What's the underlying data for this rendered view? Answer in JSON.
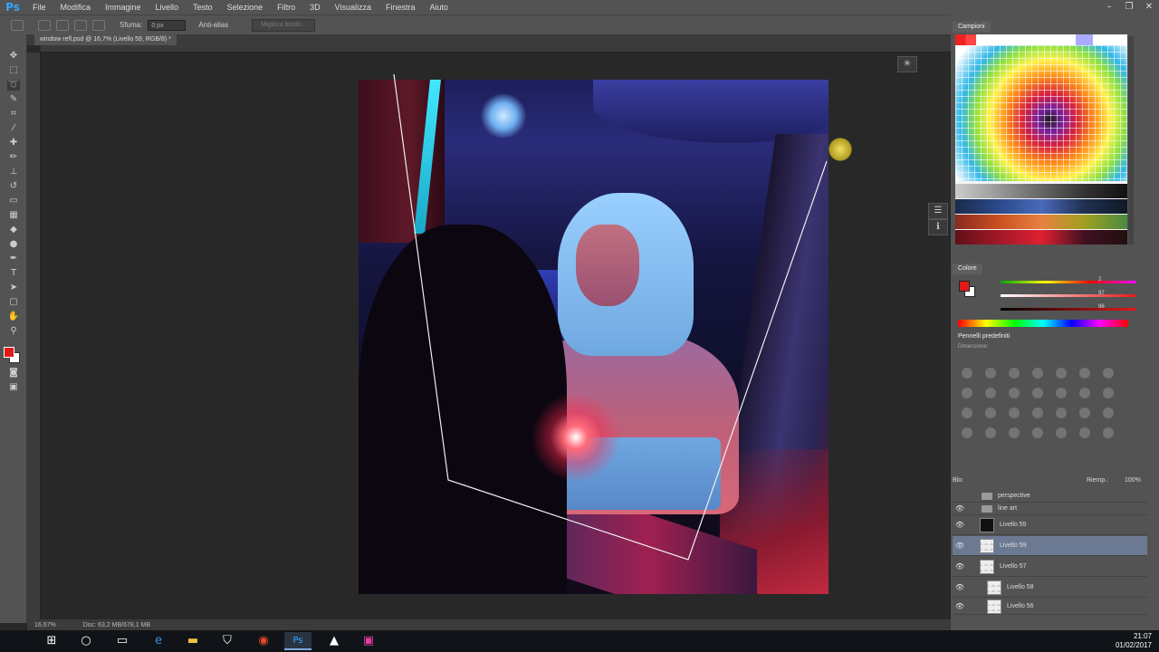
{
  "app": {
    "logo": "Ps"
  },
  "menu": [
    "File",
    "Modifica",
    "Immagine",
    "Livello",
    "Testo",
    "Selezione",
    "Filtro",
    "3D",
    "Visualizza",
    "Finestra",
    "Aiuto"
  ],
  "window_controls": {
    "minimize": "–",
    "restore": "❐",
    "close": "✕"
  },
  "options_bar": {
    "feather_label": "Sfuma:",
    "feather_value": "0 px",
    "antialias_label": "Anti-alias",
    "refine_button": "Migliora bordo..."
  },
  "document_tab": "window refl.psd @ 16,7% (Livello 59, RGB/8) *",
  "status": {
    "zoom": "16,67%",
    "doc_size": "Doc: 63,2 MB/678,1 MB"
  },
  "panels": {
    "swatches_tab": "Campioni",
    "color_tab": "Colore",
    "color_values": {
      "r": "2",
      "g": "97",
      "b": "96"
    },
    "presets_tab": "Pennelli predefiniti",
    "presets_label": "Dimensione:"
  },
  "layers": {
    "header_kind": "Blo:",
    "opacity_label": "Riemp.:",
    "opacity_value": "100%",
    "items": [
      {
        "name": "perspective",
        "type": "folder",
        "visible": false,
        "selected": false
      },
      {
        "name": "line art",
        "type": "folder",
        "visible": true,
        "selected": false
      },
      {
        "name": "Livello 55",
        "type": "layer",
        "visible": true,
        "selected": false
      },
      {
        "name": "Livello 59",
        "type": "layer",
        "visible": true,
        "selected": true
      },
      {
        "name": "Livello 57",
        "type": "layer",
        "visible": true,
        "selected": false
      },
      {
        "name": "Livello 58",
        "type": "layer",
        "visible": true,
        "selected": false
      },
      {
        "name": "Livello 56",
        "type": "layer",
        "visible": true,
        "selected": false
      }
    ]
  },
  "taskbar": {
    "apps": [
      "windows-start-icon",
      "search-icon",
      "task-view-icon",
      "edge-icon",
      "file-explorer-icon",
      "store-icon",
      "chrome-icon",
      "photoshop-icon",
      "photos-icon",
      "paint-app-icon"
    ],
    "time": "21:07",
    "date": "01/02/2017"
  },
  "colors": {
    "foreground": "#e21a1a",
    "background": "#ffffff",
    "selected_layer": "#6b7a92",
    "ps_blue": "#31a8ff"
  }
}
